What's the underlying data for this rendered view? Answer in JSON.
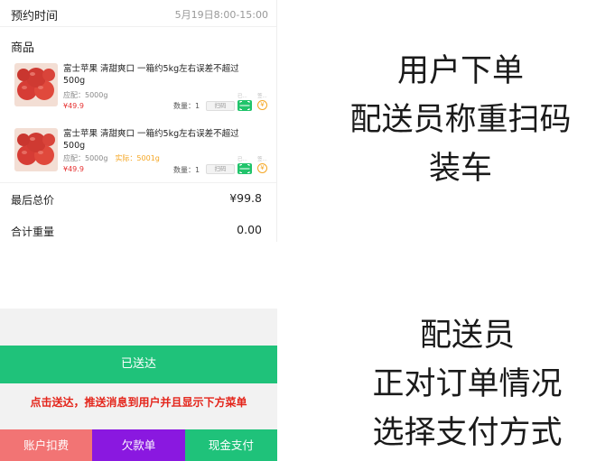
{
  "order": {
    "time_label": "预约时间",
    "time_value": "5月19日8:00-15:00",
    "goods_title": "商品",
    "items": [
      {
        "name": "富士苹果 清甜爽口 一箱约5kg左右误差不超过500g",
        "spec": "应配：5000g",
        "actual": "",
        "price": "¥49.9",
        "qty": "数量：1",
        "scan_label": "扫码",
        "mini_a": "已...",
        "mini_b": "签..."
      },
      {
        "name": "富士苹果 清甜爽口 一箱约5kg左右误差不超过500g",
        "spec": "应配：5000g",
        "actual": "实际：5001g",
        "price": "¥49.9",
        "qty": "数量：1",
        "scan_label": "扫码",
        "mini_a": "已...",
        "mini_b": "签..."
      }
    ],
    "total_label": "最后总价",
    "total_value": "¥99.8",
    "weight_label": "合计重量",
    "weight_value": "0.00"
  },
  "delivery": {
    "delivered_button": "已送达",
    "notice": "点击送达，推送消息到用户并且显示下方菜单",
    "pay_options": [
      "账户扣费",
      "欠款单",
      "现金支付"
    ]
  },
  "captions": {
    "top": [
      "用户下单",
      "配送员称重扫码",
      "装车"
    ],
    "bottom": [
      "配送员",
      "正对订单情况",
      "选择支付方式"
    ]
  },
  "colors": {
    "green": "#1fc27a",
    "red_text": "#e4251b",
    "account_pink": "#f27474",
    "credit_purple": "#8a18e0",
    "price_red": "#e63232",
    "actual_orange": "#f5a623"
  }
}
